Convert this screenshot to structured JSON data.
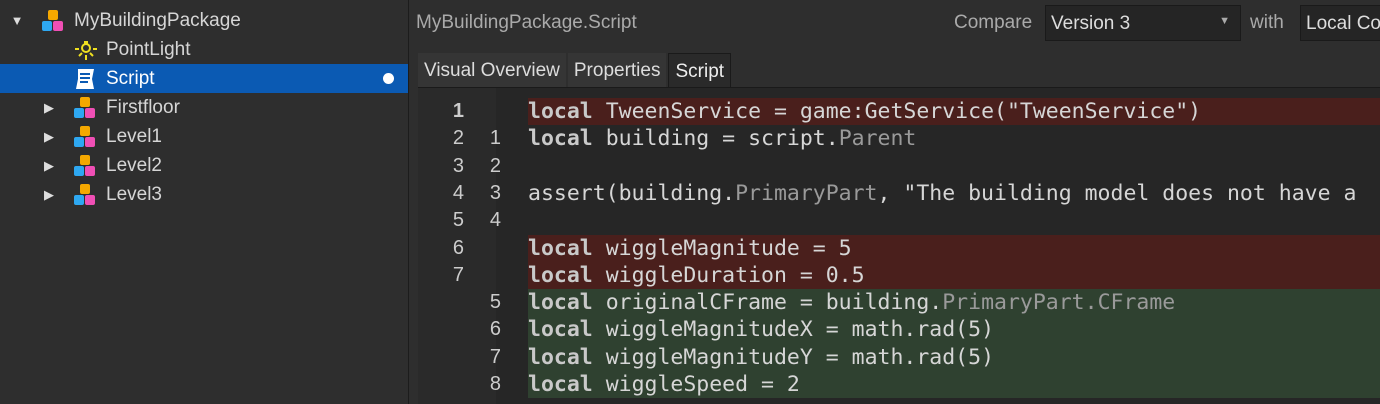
{
  "tree": {
    "items": [
      {
        "label": "MyBuildingPackage",
        "icon": "package-icon",
        "expander": "expanded"
      },
      {
        "label": "PointLight",
        "icon": "pointlight-icon"
      },
      {
        "label": "Script",
        "icon": "script-icon",
        "selected": true,
        "modified": true
      },
      {
        "label": "Firstfloor",
        "icon": "package-icon",
        "expander": "collapsed"
      },
      {
        "label": "Level1",
        "icon": "package-icon",
        "expander": "collapsed"
      },
      {
        "label": "Level2",
        "icon": "package-icon",
        "expander": "collapsed"
      },
      {
        "label": "Level3",
        "icon": "package-icon",
        "expander": "collapsed"
      }
    ]
  },
  "header": {
    "title": "MyBuildingPackage.Script",
    "compare_label": "Compare",
    "compare_value": "Version 3",
    "with_label": "with",
    "with_value": "Local Co"
  },
  "tabs": [
    {
      "label": "Visual Overview"
    },
    {
      "label": "Properties"
    },
    {
      "label": "Script",
      "active": true
    }
  ],
  "diff": [
    {
      "type": "del",
      "old": "1",
      "new": "",
      "parts": [
        [
          "kw",
          "local"
        ],
        [
          "",
          "TweenService = game:GetService(\"TweenService\")"
        ]
      ]
    },
    {
      "type": "same",
      "old": "2",
      "new": "1",
      "parts": [
        [
          "kw",
          "local"
        ],
        [
          "",
          "building = script."
        ],
        [
          "pr",
          "Parent"
        ]
      ]
    },
    {
      "type": "same",
      "old": "3",
      "new": "2",
      "parts": []
    },
    {
      "type": "same",
      "old": "4",
      "new": "3",
      "parts": [
        [
          "",
          "assert(building."
        ],
        [
          "pr",
          "PrimaryPart"
        ],
        [
          "",
          ", \"The building model does not have a"
        ]
      ]
    },
    {
      "type": "same",
      "old": "5",
      "new": "4",
      "parts": []
    },
    {
      "type": "del",
      "old": "6",
      "new": "",
      "parts": [
        [
          "kw",
          "local"
        ],
        [
          "",
          "wiggleMagnitude = 5"
        ]
      ]
    },
    {
      "type": "del",
      "old": "7",
      "new": "",
      "parts": [
        [
          "kw",
          "local"
        ],
        [
          "",
          "wiggleDuration = 0.5"
        ]
      ]
    },
    {
      "type": "add",
      "old": "",
      "new": "5",
      "parts": [
        [
          "kw",
          "local"
        ],
        [
          "",
          "originalCFrame = building."
        ],
        [
          "pr",
          "PrimaryPart.CFrame"
        ]
      ]
    },
    {
      "type": "add",
      "old": "",
      "new": "6",
      "parts": [
        [
          "kw",
          "local"
        ],
        [
          "",
          "wiggleMagnitudeX = math.rad(5)"
        ]
      ]
    },
    {
      "type": "add",
      "old": "",
      "new": "7",
      "parts": [
        [
          "kw",
          "local"
        ],
        [
          "",
          "wiggleMagnitudeY = math.rad(5)"
        ]
      ]
    },
    {
      "type": "add",
      "old": "",
      "new": "8",
      "parts": [
        [
          "kw",
          "local"
        ],
        [
          "",
          "wiggleSpeed = 2"
        ]
      ]
    }
  ],
  "colors": {
    "selection": "#0b5ab3",
    "deleted": "#4a1f1c",
    "added": "#2f4130"
  }
}
